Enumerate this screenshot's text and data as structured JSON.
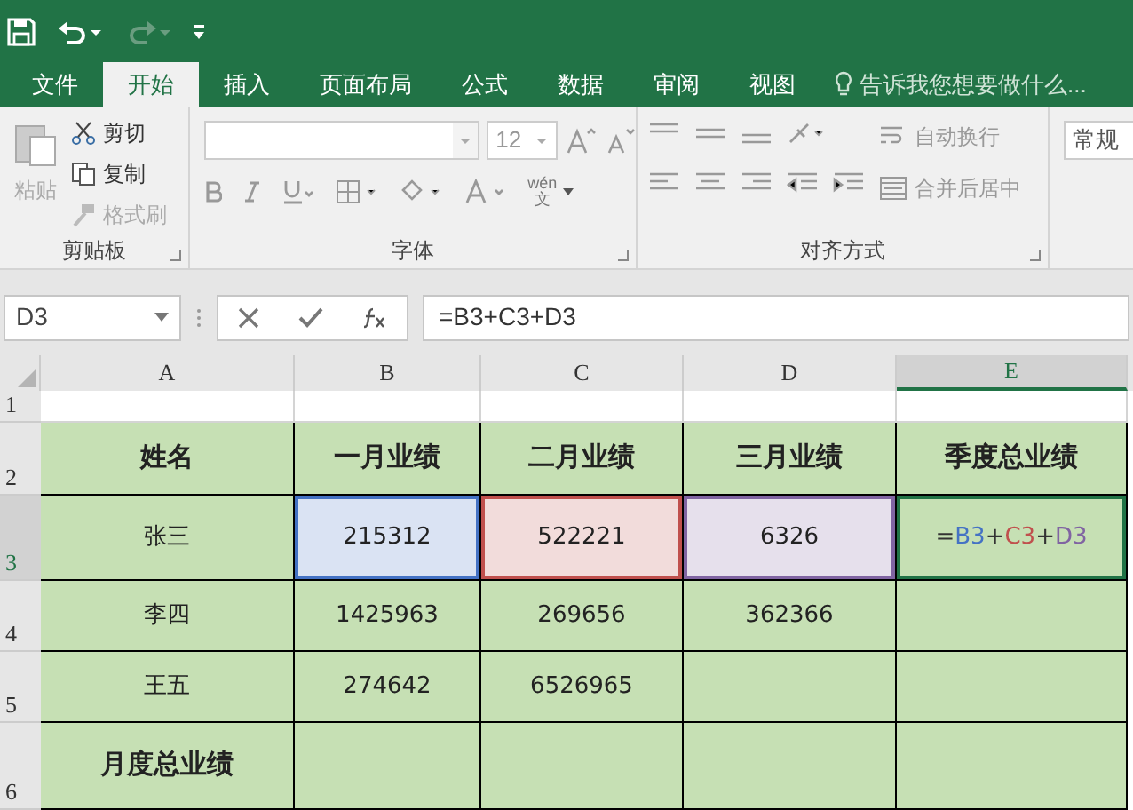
{
  "tabs": [
    {
      "label": "文件",
      "selected": false
    },
    {
      "label": "开始",
      "selected": true
    },
    {
      "label": "插入",
      "selected": false
    },
    {
      "label": "页面布局",
      "selected": false
    },
    {
      "label": "公式",
      "selected": false
    },
    {
      "label": "数据",
      "selected": false
    },
    {
      "label": "审阅",
      "selected": false
    },
    {
      "label": "视图",
      "selected": false
    }
  ],
  "tell_me": {
    "placeholder": "告诉我您想要做什么..."
  },
  "ribbon": {
    "clipboard": {
      "label": "剪贴板",
      "paste": {
        "label": "粘贴",
        "disabled": true
      },
      "items": [
        {
          "label": "剪切",
          "disabled": false
        },
        {
          "label": "复制",
          "disabled": false
        },
        {
          "label": "格式刷",
          "disabled": true
        }
      ]
    },
    "font": {
      "label": "字体",
      "size": "12",
      "phonetic": [
        "wén",
        "文"
      ]
    },
    "alignment": {
      "label": "对齐方式",
      "items": [
        "自动换行",
        "合并后居中"
      ]
    },
    "number_format": "常规"
  },
  "formula_bar": {
    "name_box": "D3",
    "formula": "=B3+C3+D3"
  },
  "columns": [
    {
      "label": "A",
      "selected": false
    },
    {
      "label": "B",
      "selected": false
    },
    {
      "label": "C",
      "selected": false
    },
    {
      "label": "D",
      "selected": false
    },
    {
      "label": "E",
      "selected": true
    }
  ],
  "rows": [
    {
      "header": "1",
      "selected": false,
      "kind": "blank",
      "cells": [
        {
          "text": ""
        },
        {
          "text": ""
        },
        {
          "text": ""
        },
        {
          "text": ""
        },
        {
          "text": ""
        }
      ]
    },
    {
      "header": "2",
      "selected": false,
      "kind": "heading",
      "cells": [
        {
          "text": "姓名"
        },
        {
          "text": "一月业绩"
        },
        {
          "text": "二月业绩"
        },
        {
          "text": "三月业绩"
        },
        {
          "text": "季度总业绩"
        }
      ]
    },
    {
      "header": "3",
      "selected": true,
      "kind": "data",
      "cells": [
        {
          "text": "张三"
        },
        {
          "text": "215312",
          "color": "#4472c4"
        },
        {
          "text": "522221",
          "color": "#c0504d"
        },
        {
          "text": "6326",
          "color": "#8064a2"
        },
        {
          "text": "",
          "active": true,
          "parts": [
            {
              "text": "=",
              "color": "#333333"
            },
            {
              "text": "B3",
              "color": "#4472c4"
            },
            {
              "text": "+",
              "color": "#333333"
            },
            {
              "text": "C3",
              "color": "#c0504d"
            },
            {
              "text": "+",
              "color": "#333333"
            },
            {
              "text": "D3",
              "color": "#8064a2"
            }
          ]
        }
      ]
    },
    {
      "header": "4",
      "selected": false,
      "kind": "data",
      "cells": [
        {
          "text": "李四"
        },
        {
          "text": "1425963"
        },
        {
          "text": "269656"
        },
        {
          "text": "362366"
        },
        {
          "text": ""
        }
      ]
    },
    {
      "header": "5",
      "selected": false,
      "kind": "data",
      "cells": [
        {
          "text": "王五"
        },
        {
          "text": "274642"
        },
        {
          "text": "6526965"
        },
        {
          "text": ""
        },
        {
          "text": ""
        }
      ]
    },
    {
      "header": "6",
      "selected": false,
      "kind": "heading",
      "cells": [
        {
          "text": "月度总业绩"
        },
        {
          "text": ""
        },
        {
          "text": ""
        },
        {
          "text": ""
        },
        {
          "text": ""
        }
      ]
    }
  ]
}
